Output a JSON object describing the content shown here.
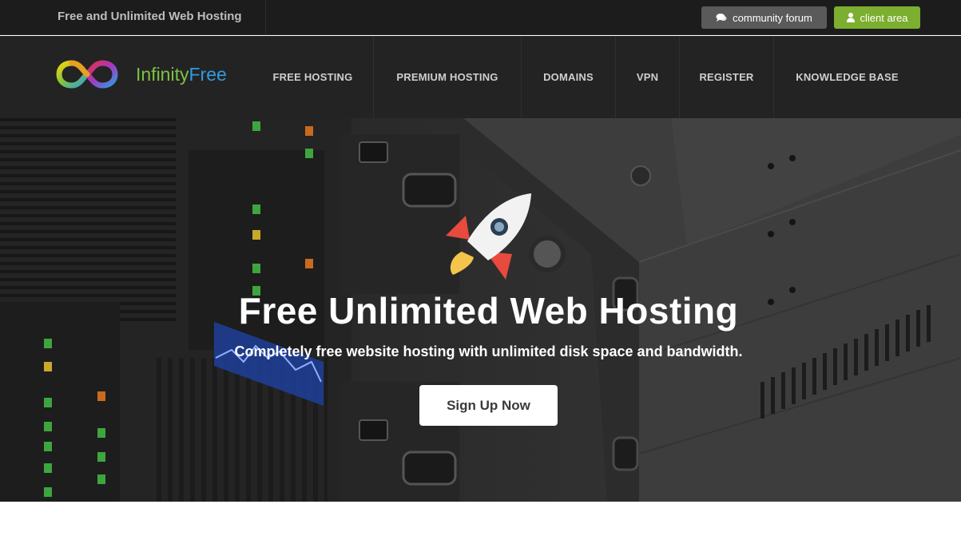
{
  "topbar": {
    "tagline": "Free and Unlimited Web Hosting",
    "forum_label": "community forum",
    "client_label": "client area",
    "forum_icon": "comments-icon",
    "client_icon": "user-icon"
  },
  "logo": {
    "text_part1": "Infinity",
    "text_part2": "Free"
  },
  "nav": {
    "items": [
      {
        "label": "FREE HOSTING"
      },
      {
        "label": "PREMIUM HOSTING"
      },
      {
        "label": "DOMAINS"
      },
      {
        "label": "VPN"
      },
      {
        "label": "REGISTER"
      },
      {
        "label": "KNOWLEDGE BASE"
      }
    ]
  },
  "hero": {
    "title": "Free Unlimited Web Hosting",
    "subtitle": "Completely free website hosting with unlimited disk space and bandwidth.",
    "cta_label": "Sign Up Now",
    "icon": "rocket-icon"
  },
  "colors": {
    "topbar_bg": "#1c1c1c",
    "nav_bg": "#232323",
    "client_button": "#7cae2f",
    "forum_button": "#5a5a5a",
    "logo_green": "#7cc243",
    "logo_blue": "#2f9be0"
  }
}
